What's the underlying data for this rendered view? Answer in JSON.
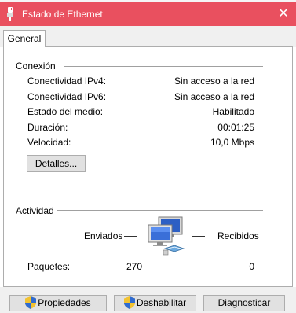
{
  "window": {
    "title": "Estado de Ethernet",
    "close_glyph": "✕"
  },
  "tabs": [
    {
      "label": "General"
    }
  ],
  "connection": {
    "heading": "Conexión",
    "rows": [
      {
        "label": "Conectividad IPv4:",
        "value": "Sin acceso a la red"
      },
      {
        "label": "Conectividad IPv6:",
        "value": "Sin acceso a la red"
      },
      {
        "label": "Estado del medio:",
        "value": "Habilitado"
      },
      {
        "label": "Duración:",
        "value": "00:01:25"
      },
      {
        "label": "Velocidad:",
        "value": "10,0 Mbps"
      }
    ],
    "details_button": "Detalles..."
  },
  "activity": {
    "heading": "Actividad",
    "sent_label": "Enviados",
    "received_label": "Recibidos",
    "packets_label": "Paquetes:",
    "packets_sent": "270",
    "packets_received": "0",
    "icon": "network-computers-icon"
  },
  "buttons": {
    "properties": "Propiedades",
    "disable": "Deshabilitar",
    "diagnose": "Diagnosticar"
  },
  "colors": {
    "titlebar": "#e9505f"
  }
}
